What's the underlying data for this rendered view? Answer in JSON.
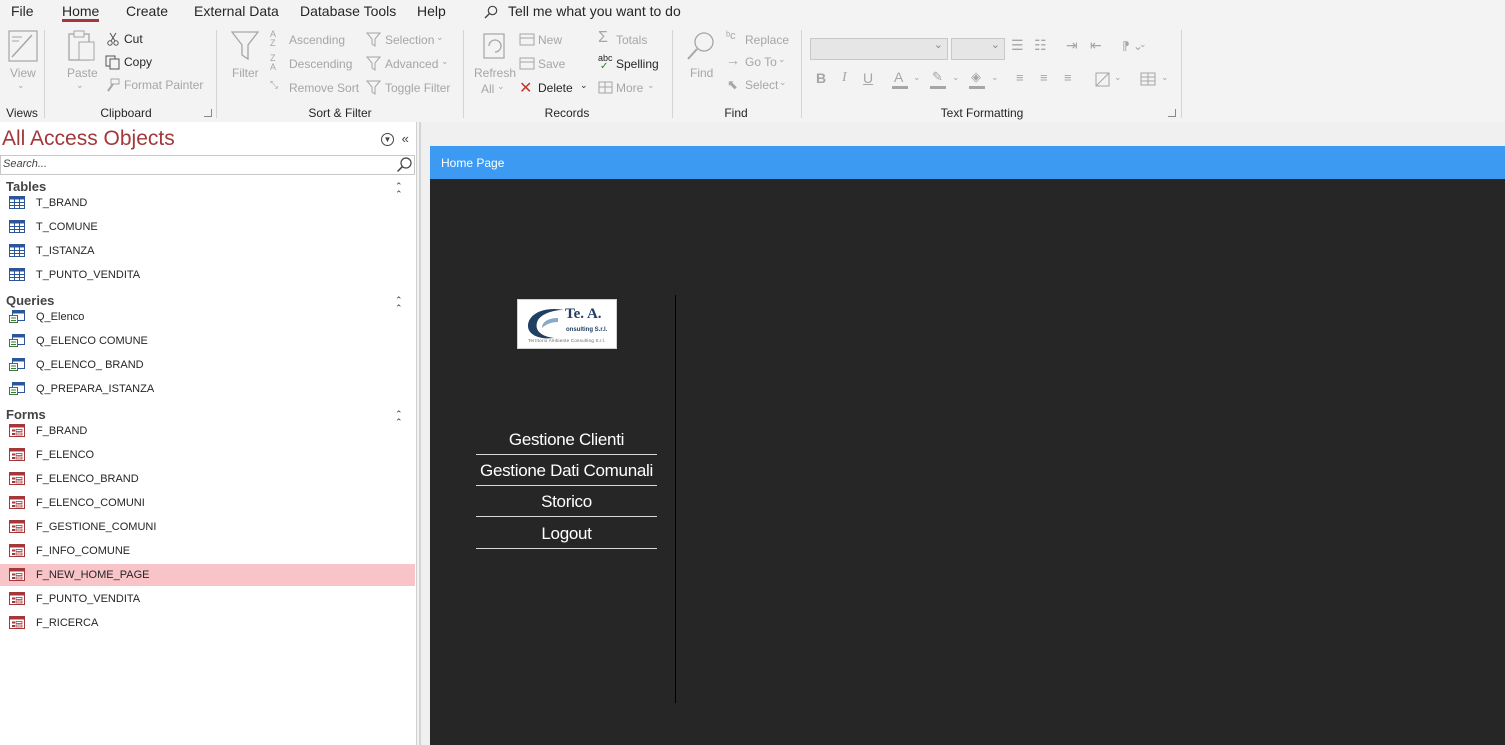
{
  "menu": {
    "tabs": [
      "File",
      "Home",
      "Create",
      "External Data",
      "Database Tools",
      "Help"
    ],
    "active_tab": "Home",
    "tell_me": "Tell me what you want to do"
  },
  "ribbon": {
    "views": {
      "view": "View",
      "group": "Views"
    },
    "clipboard": {
      "paste": "Paste",
      "cut": "Cut",
      "copy": "Copy",
      "format_painter": "Format Painter",
      "group": "Clipboard"
    },
    "sort_filter": {
      "filter": "Filter",
      "ascending": "Ascending",
      "descending": "Descending",
      "remove_sort": "Remove Sort",
      "selection": "Selection",
      "advanced": "Advanced",
      "toggle_filter": "Toggle Filter",
      "group": "Sort & Filter"
    },
    "records": {
      "refresh": "Refresh",
      "refresh_all": "All",
      "new": "New",
      "save": "Save",
      "delete": "Delete",
      "totals": "Totals",
      "spelling": "Spelling",
      "spelling_abc": "abc",
      "more": "More",
      "group": "Records"
    },
    "find": {
      "find": "Find",
      "replace": "Replace",
      "goto": "Go To",
      "select": "Select",
      "group": "Find"
    },
    "text_formatting": {
      "bold": "B",
      "italic": "I",
      "underline": "U",
      "font_color": "A",
      "group": "Text Formatting"
    }
  },
  "nav": {
    "title": "All Access Objects",
    "search_placeholder": "Search...",
    "sections": [
      {
        "label": "Tables",
        "items": [
          "T_BRAND",
          "T_COMUNE",
          "T_ISTANZA",
          "T_PUNTO_VENDITA"
        ]
      },
      {
        "label": "Queries",
        "items": [
          "Q_Elenco",
          "Q_ELENCO COMUNE",
          "Q_ELENCO_ BRAND",
          "Q_PREPARA_ISTANZA"
        ]
      },
      {
        "label": "Forms",
        "items": [
          "F_BRAND",
          "F_ELENCO",
          "F_ELENCO_BRAND",
          "F_ELENCO_COMUNI",
          "F_GESTIONE_COMUNI",
          "F_INFO_COMUNE",
          "F_NEW_HOME_PAGE",
          "F_PUNTO_VENDITA",
          "F_RICERCA"
        ]
      }
    ],
    "selected_item": "F_NEW_HOME_PAGE"
  },
  "form": {
    "tab_title": "Home Page",
    "logo": {
      "main": "Te. A.",
      "sub": "onsulting S.r.l.",
      "tagline": "Territorio  Ambiente  Consulting  S.r.l."
    },
    "buttons": [
      "Gestione Clienti",
      "Gestione Dati Comunali",
      "Storico",
      "Logout"
    ]
  },
  "colors": {
    "accent": "#a4373a",
    "form_tab": "#3d9af3",
    "form_bg": "#262626",
    "nav_selected": "#f8c4c8"
  }
}
